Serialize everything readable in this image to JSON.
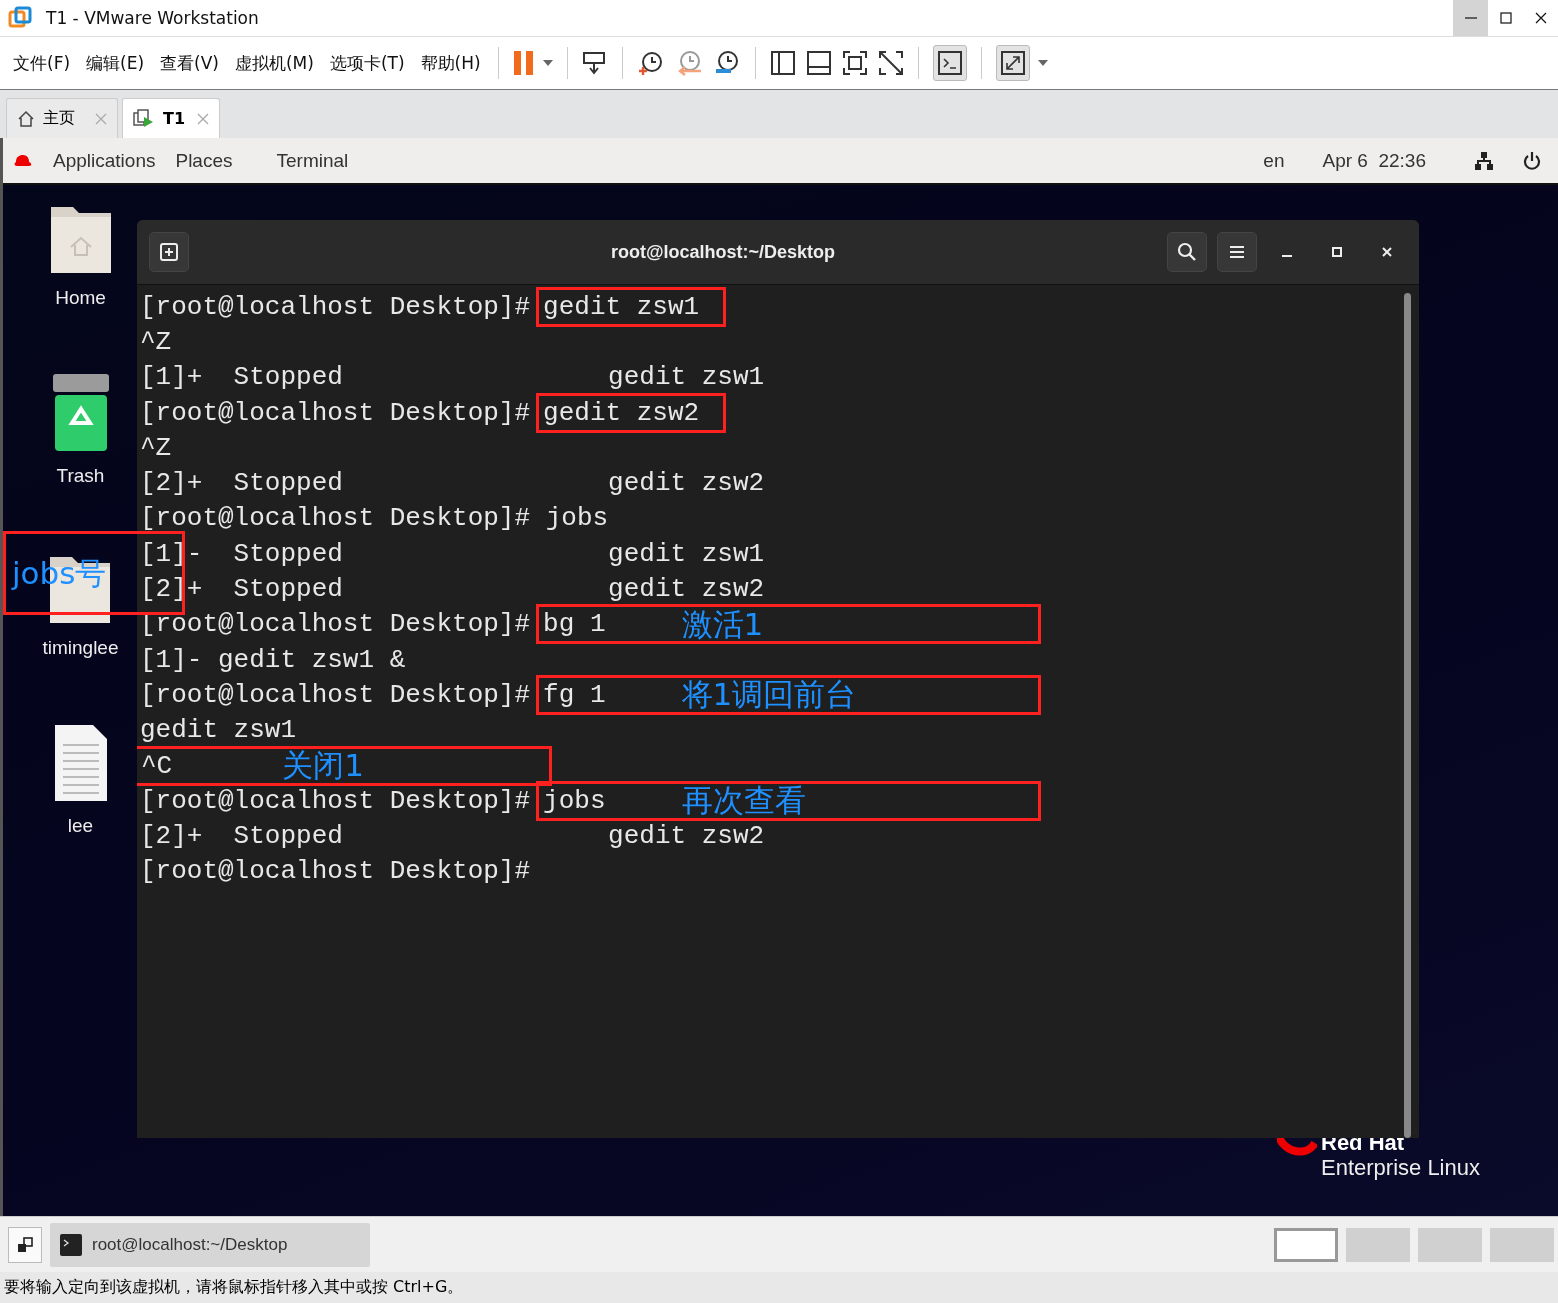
{
  "window": {
    "title": "T1 - VMware Workstation"
  },
  "menu": [
    "文件(F)",
    "编辑(E)",
    "查看(V)",
    "虚拟机(M)",
    "选项卡(T)",
    "帮助(H)"
  ],
  "tabs": [
    {
      "label": "主页",
      "selected": false,
      "kind": "home"
    },
    {
      "label": "T1",
      "selected": true,
      "kind": "vm"
    }
  ],
  "guest": {
    "top_bar": {
      "menus": [
        "Applications",
        "Places",
        "Terminal"
      ],
      "language": "en",
      "clock": "Apr 6  22:36"
    },
    "desktop_icons": [
      {
        "label": "Home",
        "kind": "home"
      },
      {
        "label": "Trash",
        "kind": "trash"
      },
      {
        "label": "timinglee",
        "kind": "folder"
      },
      {
        "label": "lee",
        "kind": "file"
      }
    ],
    "desktop_note": "jobs号",
    "terminal": {
      "title": "root@localhost:~/Desktop",
      "lines": [
        {
          "kind": "prompt",
          "prompt": "[root@localhost Desktop]#",
          "command": "gedit zsw1",
          "boxed": true
        },
        {
          "kind": "output",
          "text": "^Z",
          "boxed": false
        },
        {
          "kind": "output",
          "text": "[1]+  Stopped                 gedit zsw1",
          "boxed": false
        },
        {
          "kind": "prompt",
          "prompt": "[root@localhost Desktop]#",
          "command": "gedit zsw2",
          "boxed": true
        },
        {
          "kind": "output",
          "text": "^Z",
          "boxed": false
        },
        {
          "kind": "output",
          "text": "[2]+  Stopped                 gedit zsw2",
          "boxed": false
        },
        {
          "kind": "prompt",
          "prompt": "[root@localhost Desktop]#",
          "command": "jobs",
          "boxed": false
        },
        {
          "kind": "output",
          "text": "[1]-  Stopped                 gedit zsw1",
          "boxed": false
        },
        {
          "kind": "output",
          "text": "[2]+  Stopped                 gedit zsw2",
          "boxed": false
        },
        {
          "kind": "prompt",
          "prompt": "[root@localhost Desktop]#",
          "command": "bg 1",
          "boxed": true,
          "note": "激活1"
        },
        {
          "kind": "output",
          "text": "[1]- gedit zsw1 &",
          "boxed": false
        },
        {
          "kind": "prompt",
          "prompt": "[root@localhost Desktop]#",
          "command": "fg 1",
          "boxed": true,
          "note": "将1调回前台"
        },
        {
          "kind": "output",
          "text": "gedit zsw1",
          "boxed": false
        },
        {
          "kind": "output",
          "text": "^C",
          "boxed": true,
          "note": "关闭1"
        },
        {
          "kind": "prompt",
          "prompt": "[root@localhost Desktop]#",
          "command": "jobs",
          "boxed": true,
          "note": "再次查看"
        },
        {
          "kind": "output",
          "text": "[2]+  Stopped                 gedit zsw2",
          "boxed": false
        },
        {
          "kind": "prompt",
          "prompt": "[root@localhost Desktop]#",
          "boxed": false
        }
      ]
    },
    "branding": [
      "Red Hat",
      "Enterprise Linux"
    ]
  },
  "taskbar": {
    "item": "root@localhost:~/Desktop"
  },
  "thumbnails": [
    {
      "selected": true
    },
    {
      "selected": false
    },
    {
      "selected": false
    },
    {
      "selected": false
    }
  ],
  "status_bar": "要将输入定向到该虚拟机，请将鼠标指针移入其中或按 Ctrl+G。"
}
